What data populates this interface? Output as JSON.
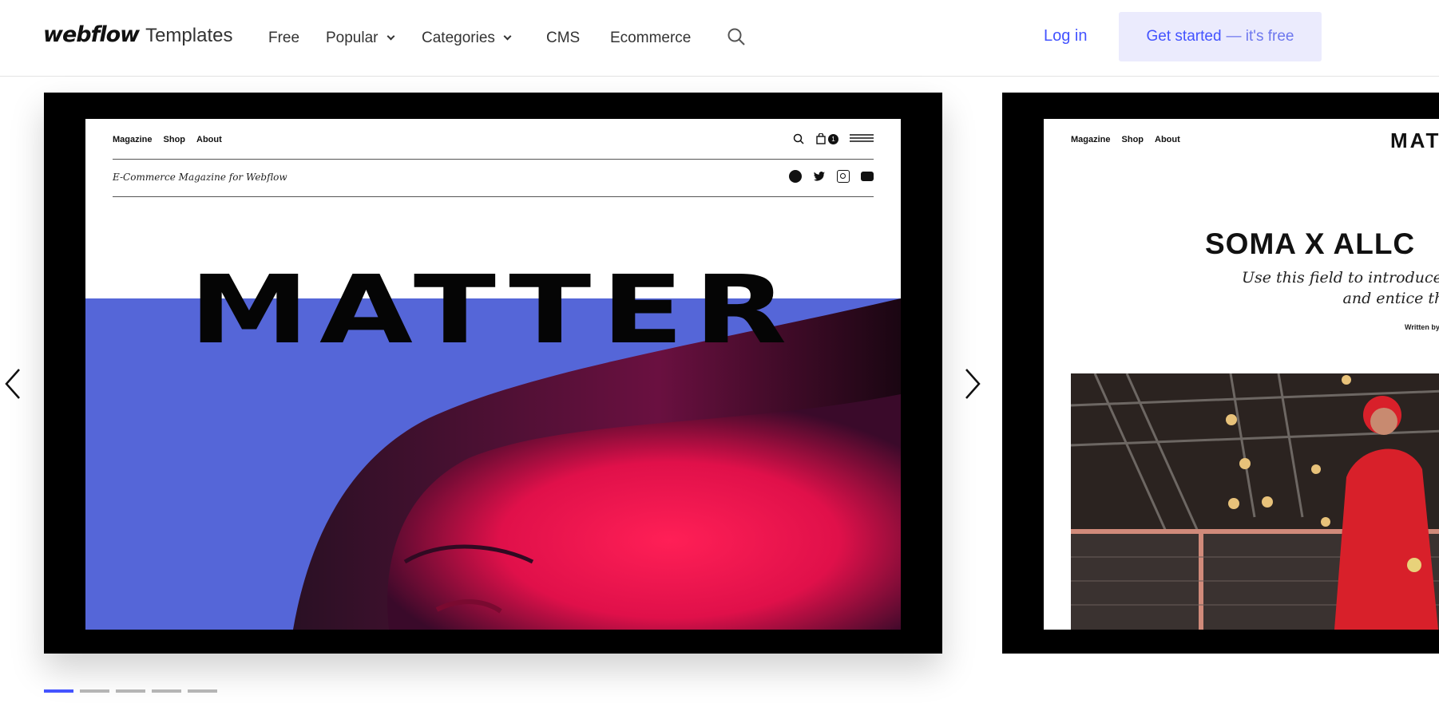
{
  "header": {
    "brand_wordmark": "webflow",
    "brand_sub": "Templates",
    "nav": [
      {
        "label": "Free",
        "has_dropdown": false
      },
      {
        "label": "Popular",
        "has_dropdown": true
      },
      {
        "label": "Categories",
        "has_dropdown": true
      },
      {
        "label": "CMS",
        "has_dropdown": false
      },
      {
        "label": "Ecommerce",
        "has_dropdown": false
      }
    ],
    "search_icon": "search-icon",
    "login_label": "Log in",
    "cta_label": "Get started",
    "cta_suffix": "— it's free",
    "accent_color": "#4353ff"
  },
  "carousel": {
    "active_index": 0,
    "slide_count": 5,
    "slides": [
      {
        "nav": [
          "Magazine",
          "Shop",
          "About"
        ],
        "cart_count": "1",
        "tagline": "E-Commerce Magazine for Webflow",
        "hero_word": "MATTER",
        "social_icons": [
          "facebook-icon",
          "twitter-icon",
          "instagram-icon",
          "youtube-icon"
        ]
      },
      {
        "nav": [
          "Magazine",
          "Shop",
          "About"
        ],
        "brand": "MAT",
        "title": "SOMA X ALLC",
        "intro_line1": "Use this field to introduce t",
        "intro_line2": "and entice the",
        "written_by": "Written by"
      }
    ]
  }
}
